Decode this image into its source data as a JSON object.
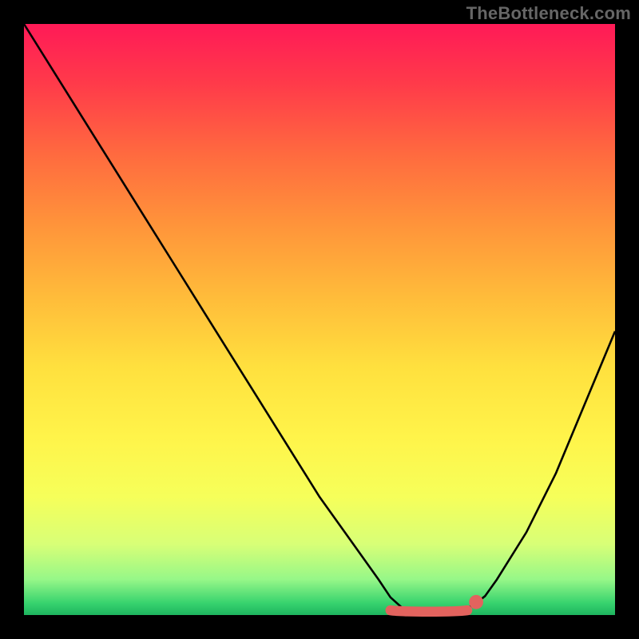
{
  "attribution": "TheBottleneck.com",
  "chart_data": {
    "type": "line",
    "title": "",
    "xlabel": "",
    "ylabel": "",
    "xlim": [
      0,
      100
    ],
    "ylim": [
      0,
      100
    ],
    "grid": false,
    "legend": false,
    "series": [
      {
        "name": "bottleneck-curve",
        "x": [
          0,
          5,
          10,
          15,
          20,
          25,
          30,
          35,
          40,
          45,
          50,
          55,
          60,
          62,
          64,
          66,
          68,
          70,
          72,
          74,
          76,
          78,
          80,
          85,
          90,
          95,
          100
        ],
        "y": [
          100,
          92,
          84,
          76,
          68,
          60,
          52,
          44,
          36,
          28,
          20,
          13,
          6,
          3,
          1.2,
          0.6,
          0.5,
          0.5,
          0.6,
          0.9,
          1.6,
          3.2,
          6,
          14,
          24,
          36,
          48
        ]
      }
    ],
    "markers": [
      {
        "name": "valley-segment",
        "x_start": 62,
        "x_end": 75,
        "y": 0.8,
        "color": "#e2635e"
      },
      {
        "name": "valley-point",
        "x": 76.5,
        "y": 2.2,
        "r": 1.2,
        "color": "#e2635e"
      }
    ],
    "colors": {
      "curve": "#000000",
      "marker": "#e2635e",
      "gradient_top": "#ff1a57",
      "gradient_bottom": "#1eb45f"
    }
  }
}
